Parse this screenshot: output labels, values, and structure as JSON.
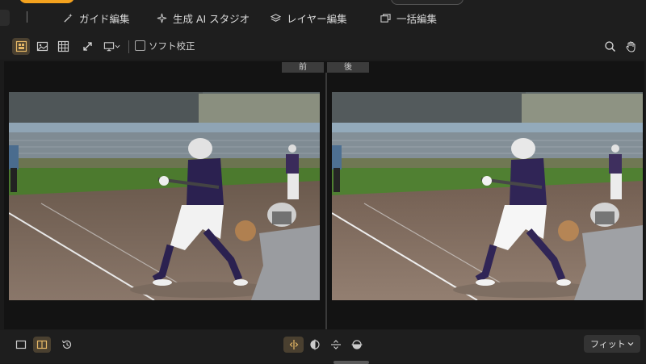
{
  "tabs": [
    {
      "label": "ガイド編集",
      "icon": "wand-icon"
    },
    {
      "label": "生成 AI スタジオ",
      "icon": "sparkle-icon"
    },
    {
      "label": "レイヤー編集",
      "icon": "layers-icon"
    },
    {
      "label": "一括編集",
      "icon": "batch-icon"
    }
  ],
  "toolbar": {
    "tools": [
      "grid-view-icon",
      "image-icon",
      "table-grid-icon",
      "expand-icon",
      "monitor-icon"
    ],
    "soft_proof_label": "ソフト校正",
    "right_tools": [
      "search-icon",
      "hand-icon"
    ]
  },
  "compare": {
    "before_label": "前",
    "after_label": "後"
  },
  "bottom": {
    "fit_label": "フィット"
  },
  "colors": {
    "accent": "#f4a21e",
    "active_bg": "#4a4030",
    "background": "#1b1b1b"
  }
}
